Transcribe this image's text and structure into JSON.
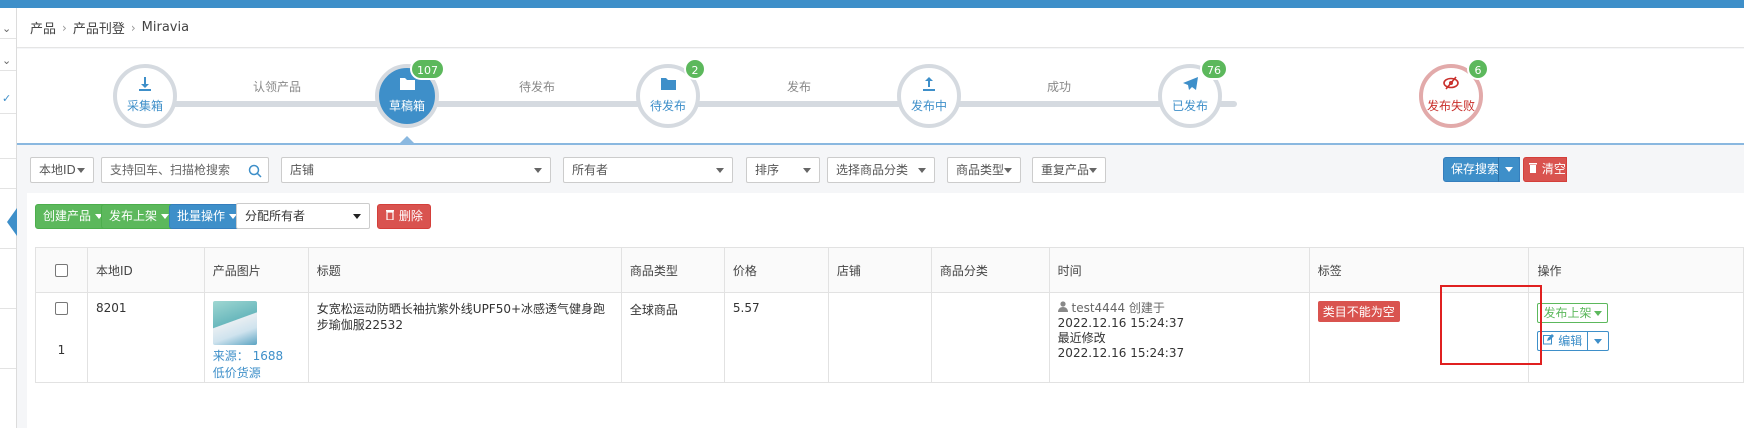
{
  "breadcrumb": {
    "items": [
      "产品",
      "产品刊登",
      "Miravia"
    ],
    "sep": "›"
  },
  "steps": [
    {
      "label": "采集箱",
      "badge": null,
      "icon": "download-icon",
      "state": "normal"
    },
    {
      "label": "草稿箱",
      "badge": "107",
      "icon": "folder-icon",
      "state": "active"
    },
    {
      "label": "待发布",
      "badge": "2",
      "icon": "folder-icon",
      "state": "normal"
    },
    {
      "label": "发布中",
      "badge": null,
      "icon": "upload-icon",
      "state": "normal"
    },
    {
      "label": "已发布",
      "badge": "76",
      "icon": "paper-plane-icon",
      "state": "normal"
    },
    {
      "label": "发布失败",
      "badge": "6",
      "icon": "eye-slash-icon",
      "state": "fail"
    }
  ],
  "connectors": [
    "认领产品",
    "待发布",
    "发布",
    "成功"
  ],
  "filters": {
    "local_id": "本地ID",
    "search_placeholder": "支持回车、扫描枪搜索",
    "store": "店铺",
    "owner": "所有者",
    "sort": "排序",
    "category": "选择商品分类",
    "product_type": "商品类型",
    "duplicate": "重复产品",
    "save_search": "保存搜索",
    "clear": "清空"
  },
  "toolbar": {
    "create": "创建产品",
    "publish": "发布上架",
    "batch": "批量操作",
    "assign_owner": "分配所有者",
    "delete": "删除"
  },
  "table": {
    "headers": [
      "本地ID",
      "产品图片",
      "标题",
      "商品类型",
      "价格",
      "店铺",
      "商品分类",
      "时间",
      "标签",
      "操作"
    ],
    "rows": [
      {
        "index": "1",
        "local_id": "8201",
        "source": "来源： 1688",
        "source_type": "低价货源",
        "title": "女宽松运动防晒长袖抗紫外线UPF50+冰感透气健身跑步瑜伽服22532",
        "product_type": "全球商品",
        "price": "5.57",
        "store": "",
        "category": "",
        "creator": "test4444 创建于",
        "created": "2022.12.16 15:24:37",
        "modified_label": "最近修改",
        "modified": "2022.12.16 15:24:37",
        "tag": "类目不能为空",
        "op_publish": "发布上架",
        "op_edit": "编辑"
      }
    ]
  },
  "colors": {
    "primary": "#3e8fc9",
    "success": "#5cb85c",
    "danger": "#d9534f",
    "highlight": "#e02020"
  }
}
